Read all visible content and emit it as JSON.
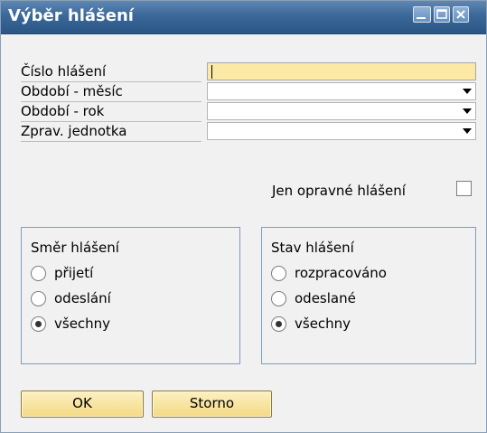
{
  "window": {
    "title": "Výběr hlášení"
  },
  "fields": [
    {
      "label": "Číslo hlášení",
      "value": "",
      "type": "text"
    },
    {
      "label": "Období - měsíc",
      "value": "",
      "type": "select"
    },
    {
      "label": "Období - rok",
      "value": "",
      "type": "select"
    },
    {
      "label": "Zprav. jednotka",
      "value": "",
      "type": "select"
    }
  ],
  "corrective": {
    "label": "Jen opravné hlášení",
    "checked": false
  },
  "direction_group": {
    "title": "Směr hlášení",
    "options": [
      "přijetí",
      "odeslání",
      "všechny"
    ],
    "selected": "všechny"
  },
  "status_group": {
    "title": "Stav hlášení",
    "options": [
      "rozpracováno",
      "odeslané",
      "všechny"
    ],
    "selected": "všechny"
  },
  "buttons": {
    "ok": "OK",
    "cancel": "Storno"
  },
  "icons": {
    "minimize": "minimize-icon",
    "maximize": "maximize-icon",
    "close": "close-icon"
  }
}
